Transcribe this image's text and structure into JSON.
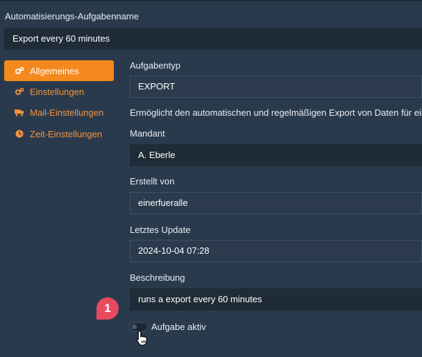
{
  "task_name": {
    "label": "Automatisierungs-Aufgabenname",
    "value": "Export every 60 minutes"
  },
  "sidebar": {
    "items": [
      {
        "label": "Allgemeines",
        "icon": "gears-icon",
        "active": true
      },
      {
        "label": "Einstellungen",
        "icon": "gears-icon",
        "active": false
      },
      {
        "label": "Mail-Einstellungen",
        "icon": "mail-truck-icon",
        "active": false
      },
      {
        "label": "Zeit-Einstellungen",
        "icon": "clock-icon",
        "active": false
      }
    ]
  },
  "form": {
    "aufgabentyp_label": "Aufgabentyp",
    "aufgabentyp_value": "EXPORT",
    "description_text": "Ermöglicht den automatischen und regelmäßigen Export von Daten für ein",
    "mandant_label": "Mandant",
    "mandant_value": "A. Eberle",
    "erstellt_label": "Erstellt von",
    "erstellt_value": "einerfueralle",
    "update_label": "Letztes Update",
    "update_value": "2024-10-04 07:28",
    "beschreibung_label": "Beschreibung",
    "beschreibung_value": "runs a export every 60 minutes",
    "aktiv_label": "Aufgabe aktiv"
  },
  "annotation": {
    "step": "1"
  },
  "colors": {
    "accent": "#f48a1e",
    "background": "#2a3a4d",
    "badge": "#e84a5f"
  }
}
